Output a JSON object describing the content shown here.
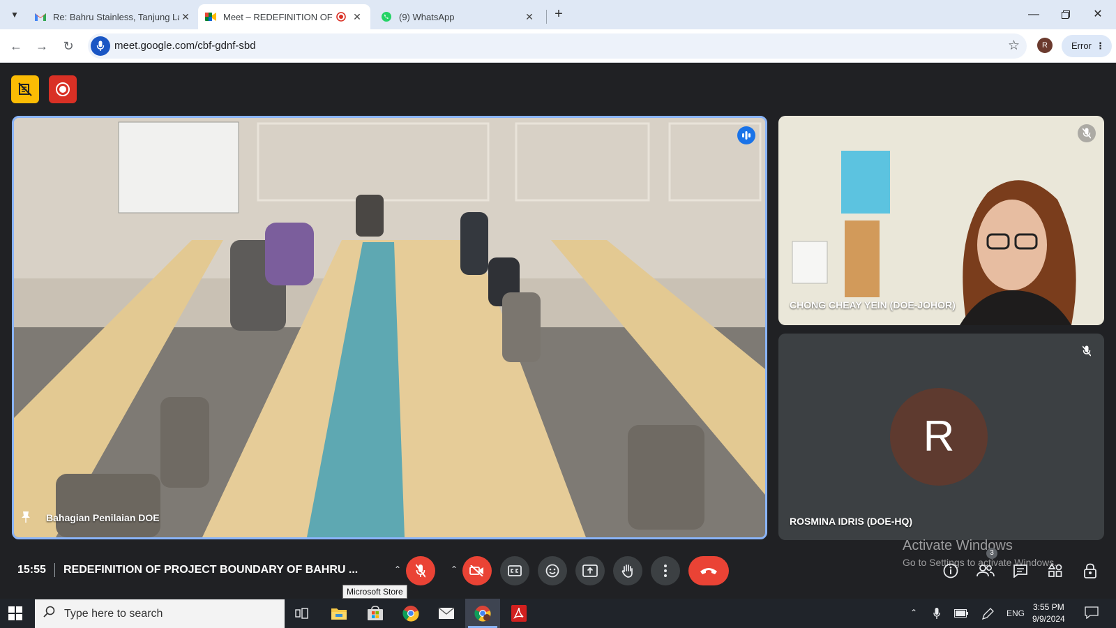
{
  "browser": {
    "tabs": [
      {
        "title": "Re: Bahru Stainless, Tanjung Lan",
        "icon": "gmail-icon"
      },
      {
        "title": "Meet – REDEFINITION OF P",
        "icon": "meet-icon",
        "active": true,
        "recording": true
      },
      {
        "title": "(9) WhatsApp",
        "icon": "whatsapp-icon"
      }
    ],
    "url": "meet.google.com/cbf-gdnf-sbd",
    "profile_initial": "R",
    "error_label": "Error"
  },
  "meet": {
    "main_tile": {
      "name": "Bahagian Penilaian DOE",
      "pinned": true,
      "speaking": true
    },
    "side_tiles": [
      {
        "name": "CHONG CHEAY YEIN (DOE-JOHOR)",
        "muted": true
      },
      {
        "name": "ROSMINA IDRIS (DOE-HQ)",
        "muted": true,
        "avatar_initial": "R"
      }
    ],
    "time": "15:55",
    "meeting_title": "REDEFINITION OF PROJECT BOUNDARY OF BAHRU ...",
    "people_count": "3",
    "tooltip": "Microsoft Store"
  },
  "watermark": {
    "line1": "Activate Windows",
    "line2": "Go to Settings to activate Windows."
  },
  "taskbar": {
    "search_placeholder": "Type here to search",
    "language": "ENG",
    "time": "3:55 PM",
    "date": "9/9/2024"
  },
  "colors": {
    "accent": "#8ab4f8",
    "hangup": "#ea4335",
    "meet_bg": "#202124",
    "avatar": "#5e3a2f"
  }
}
